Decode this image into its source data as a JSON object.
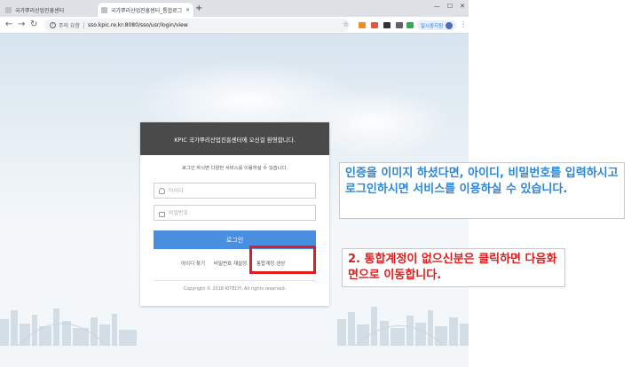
{
  "browser": {
    "tabs": [
      {
        "title": "국가뿌리산업진흥센터",
        "active": false
      },
      {
        "title": "국가뿌리산업진흥센터_통합로그",
        "active": true
      }
    ],
    "new_tab_icon": "+",
    "window_controls": [
      "—",
      "☐",
      "✕"
    ],
    "security_label": "주의 요함",
    "url": "sso.kpic.re.kr:8080/sso/usr/login/view",
    "profile_label": "일시중지됨",
    "icons": {
      "back": "arrow-left-icon",
      "forward": "arrow-right-icon",
      "reload": "reload-icon",
      "star": "star-icon",
      "menu": "kebab-menu-icon"
    }
  },
  "login": {
    "header_title": "KPIC 국가뿌리산업진흥센터에 오신걸 환영합니다.",
    "guide_text": "로그인 하시면 다양한 서비스를 이용하실 수 있습니다.",
    "id_placeholder": "아이디",
    "password_placeholder": "비밀번호",
    "login_button": "로그인",
    "links": {
      "find_id": "아이디 찾기",
      "reset_password": "비밀번호 재설정",
      "create_account": "통합계정 생성"
    },
    "copyright": "Copyright © 2018 KITECH. All rights reserved."
  },
  "annotations": {
    "blue_text": "인증을 이미지 하셨다면, 아이디, 비밀번호를 입력하시고 로그인하시면 서비스를 이용하실 수 있습니다.",
    "red_text": "2. 통합계정이 없으신분은 클릭하면 다음화면으로 이동합니다.",
    "blue_color": "#2e86d6",
    "red_color": "#e01c1c"
  }
}
